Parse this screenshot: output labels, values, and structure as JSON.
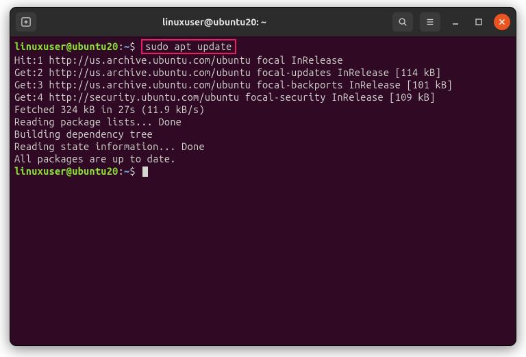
{
  "window": {
    "title": "linuxuser@ubuntu20: ~"
  },
  "prompt": {
    "user_host": "linuxuser@ubuntu20",
    "separator": ":",
    "path": "~",
    "symbol": "$"
  },
  "command": {
    "text": "sudo apt update"
  },
  "output": {
    "lines": [
      "Hit:1 http://us.archive.ubuntu.com/ubuntu focal InRelease",
      "Get:2 http://us.archive.ubuntu.com/ubuntu focal-updates InRelease [114 kB]",
      "Get:3 http://us.archive.ubuntu.com/ubuntu focal-backports InRelease [101 kB]",
      "Get:4 http://security.ubuntu.com/ubuntu focal-security InRelease [109 kB]",
      "Fetched 324 kB in 27s (11.9 kB/s)",
      "Reading package lists... Done",
      "Building dependency tree",
      "Reading state information... Done",
      "All packages are up to date."
    ]
  }
}
